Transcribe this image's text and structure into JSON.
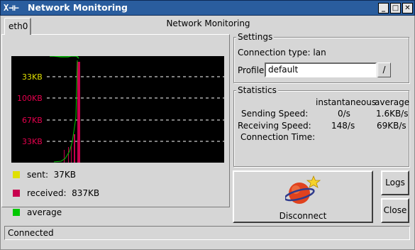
{
  "window": {
    "title": "Network Monitoring",
    "icon_text": "X⊣⊢",
    "controls": {
      "minimize": "_",
      "maximize": "□",
      "close": "✕"
    }
  },
  "heading": "Network Monitoring",
  "tab": {
    "label": "eth0"
  },
  "graph": {
    "axis_labels": [
      "33KB",
      "100KB",
      "67KB",
      "33KB"
    ],
    "colors": {
      "sent": "#e0e000",
      "received": "#c8004e",
      "average": "#00c800"
    }
  },
  "legend": [
    {
      "label": "sent:",
      "value": "37KB",
      "color": "#e0e000"
    },
    {
      "label": "received:",
      "value": "837KB",
      "color": "#c8004e"
    },
    {
      "label": "average",
      "value": "",
      "color": "#00c800"
    }
  ],
  "settings": {
    "title": "Settings",
    "connection_type": "Connection type: lan",
    "profile_label": "Profile",
    "profile_value": "default",
    "profile_button": "/"
  },
  "statistics": {
    "title": "Statistics",
    "col_instant": "instantaneous",
    "col_average": "average",
    "rows": [
      {
        "label": "Sending Speed:",
        "instant": "0/s",
        "average": "1.6KB/s"
      },
      {
        "label": "Receiving Speed:",
        "instant": "148/s",
        "average": "69KB/s"
      },
      {
        "label": "Connection Time:",
        "instant": "",
        "average": ""
      }
    ]
  },
  "buttons": {
    "disconnect": "Disconnect",
    "logs": "Logs",
    "close": "Close"
  },
  "status": "Connected"
}
